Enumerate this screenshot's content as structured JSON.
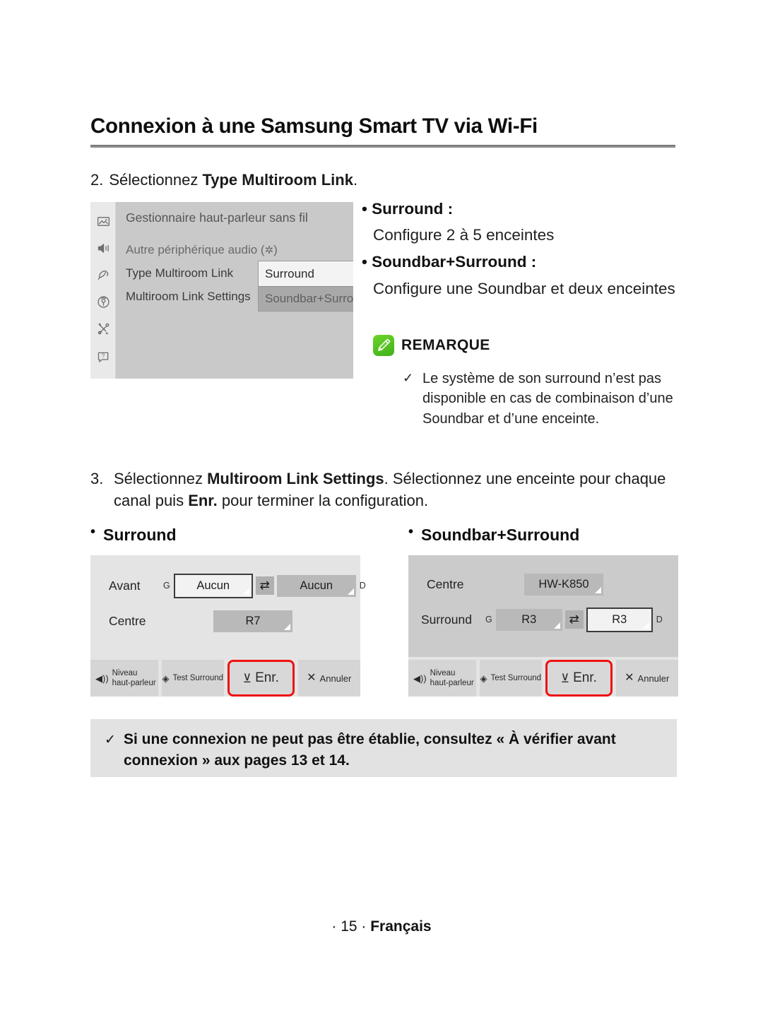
{
  "header": {
    "title": "Connexion à une Samsung Smart TV via Wi-Fi"
  },
  "step2": {
    "number": "2.",
    "text_before": "Sélectionnez ",
    "bold": "Type Multiroom Link",
    "text_after": "."
  },
  "tv_menu": {
    "title": "Gestionnaire haut-parleur sans fil",
    "rows": [
      {
        "label": "Autre périphérique audio (",
        "suffix": ")",
        "icon": "bluetooth-icon"
      },
      {
        "label": "Type Multiroom Link"
      },
      {
        "label": "Multiroom Link Settings"
      }
    ],
    "sidebar_icons": [
      "picture-icon",
      "sound-icon",
      "broadcast-dish-icon",
      "network-antenna-icon",
      "system-tools-icon",
      "support-help-icon"
    ],
    "dropdown": {
      "selected": "Surround",
      "check_glyph": "✓",
      "other": "Soundbar+Surround"
    }
  },
  "description": {
    "item1_title": "• Surround :",
    "item1_body": "Configure 2 à 5 enceintes",
    "item2_title": "• Soundbar+Surround :",
    "item2_body": "Configure une Soundbar et deux enceintes"
  },
  "remarque": {
    "label": "REMARQUE",
    "check_glyph": "✓",
    "text": "Le système de son surround n’est pas disponible en cas de combinaison d’une Soundbar et d’une enceinte."
  },
  "step3": {
    "number": "3.",
    "part1": "Sélectionnez ",
    "bold1": "Multiroom Link Settings",
    "part2": ". Sélectionnez une enceinte pour chaque canal puis ",
    "bold2": "Enr.",
    "part3": " pour terminer la configuration."
  },
  "sub_headings": {
    "left": "Surround",
    "right": "Soundbar+Surround"
  },
  "panel_left": {
    "rows": [
      {
        "label": "Avant",
        "left_letter": "G",
        "left_value": "Aucun",
        "swap_glyph": "⇄",
        "right_letter": "D",
        "right_value": "Aucun"
      },
      {
        "label": "Centre",
        "value": "R7"
      }
    ],
    "buttons": [
      {
        "name": "niveau-haut-parleur",
        "icon": "speaker-level-icon",
        "line1": "Niveau",
        "line2": "haut-parleur"
      },
      {
        "name": "test-surround",
        "icon": "test-surround-icon",
        "label": "Test Surround"
      },
      {
        "name": "enregistrer",
        "icon": "save-icon",
        "label": "Enr."
      },
      {
        "name": "annuler",
        "icon": "close-x-icon",
        "label": "Annuler"
      }
    ]
  },
  "panel_right": {
    "rows": [
      {
        "label": "Centre",
        "value": "HW-K850"
      },
      {
        "label": "Surround",
        "left_letter": "G",
        "left_value": "R3",
        "swap_glyph": "⇄",
        "right_letter": "D",
        "right_value": "R3"
      }
    ],
    "buttons": [
      {
        "name": "niveau-haut-parleur",
        "icon": "speaker-level-icon",
        "line1": "Niveau",
        "line2": "haut-parleur"
      },
      {
        "name": "test-surround",
        "icon": "test-surround-icon",
        "label": "Test Surround"
      },
      {
        "name": "enregistrer",
        "icon": "save-icon",
        "label": "Enr."
      },
      {
        "name": "annuler",
        "icon": "close-x-icon",
        "label": "Annuler"
      }
    ]
  },
  "note_box": {
    "check_glyph": "✓",
    "text": "Si une connexion ne peut pas être établie, consultez « À vérifier avant connexion » aux pages 13 et 14."
  },
  "footer": {
    "text": "· 15 · ",
    "language": "Français"
  },
  "colors": {
    "accent_red": "#ef1111",
    "note_green": "#4fbf1e",
    "panel_bg": "#e4e4e4",
    "menu_bg": "#c9c9c9",
    "note_box_bg": "#e2e2e2"
  }
}
